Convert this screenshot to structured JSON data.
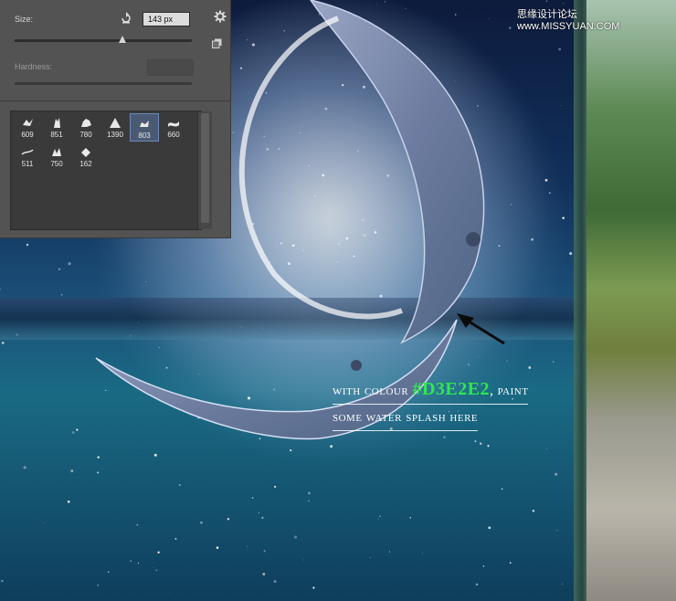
{
  "watermark": "思缘设计论坛 www.MISSYUAN.COM",
  "brush_panel": {
    "size_label": "Size:",
    "size_value": "143 px",
    "size_slider_level": 0.61,
    "hardness_label": "Hardness:",
    "reset_icon": "reset-icon",
    "settings_icon": "gear-icon",
    "new_preset_icon": "new-preset-icon",
    "brushes": [
      {
        "number": "609",
        "selected": false
      },
      {
        "number": "851",
        "selected": false
      },
      {
        "number": "780",
        "selected": false
      },
      {
        "number": "1390",
        "selected": false
      },
      {
        "number": "803",
        "selected": true
      },
      {
        "number": "660",
        "selected": false
      },
      {
        "number": "511",
        "selected": false
      },
      {
        "number": "750",
        "selected": false
      },
      {
        "number": "162",
        "selected": false
      }
    ]
  },
  "annotation": {
    "prefix": "with colour ",
    "color_code": "#D3E2E2",
    "suffix": ", paint",
    "line2": "some water splash here"
  },
  "colors": {
    "panel_bg": "#535353",
    "hex_highlight": "#2ee84c",
    "annotation_text": "#ffffff"
  }
}
